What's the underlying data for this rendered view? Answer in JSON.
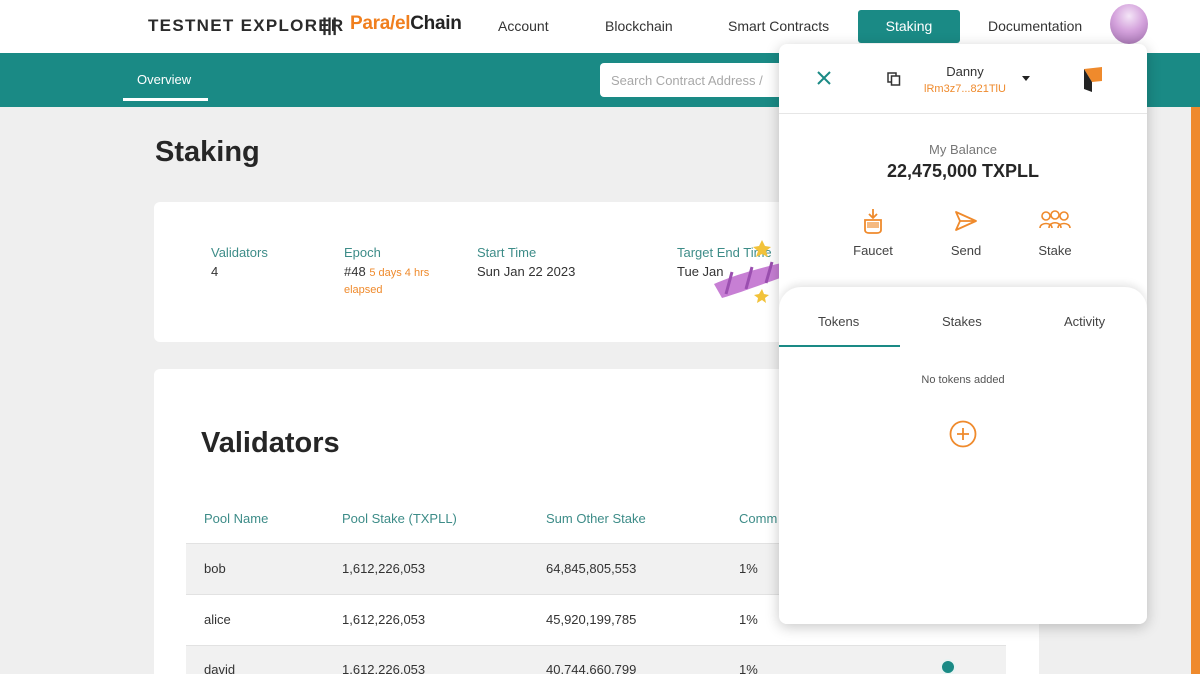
{
  "header": {
    "brand": "TESTNET EXPLORER",
    "separator": "|||",
    "logo_part1": "Para",
    "logo_part2": "/el",
    "logo_part3": "Chain",
    "nav": [
      "Account",
      "Blockchain",
      "Smart Contracts",
      "Staking",
      "Documentation"
    ]
  },
  "subheader": {
    "tab": "Overview",
    "search_placeholder": "Search Contract Address /"
  },
  "page": {
    "title": "Staking",
    "stats": {
      "validators_label": "Validators",
      "validators_value": "4",
      "epoch_label": "Epoch",
      "epoch_value": "#48",
      "epoch_elapsed_1": "5 days 4 hrs",
      "epoch_elapsed_2": "elapsed",
      "start_label": "Start Time",
      "start_value": "Sun Jan 22 2023",
      "end_label": "Target End Time",
      "end_value": "Tue Jan"
    },
    "validators_title": "Validators",
    "columns": [
      "Pool Name",
      "Pool Stake (TXPLL)",
      "Sum Other Stake",
      "Comm"
    ],
    "rows": [
      {
        "name": "bob",
        "stake": "1,612,226,053",
        "other": "64,845,805,553",
        "comm": "1%"
      },
      {
        "name": "alice",
        "stake": "1,612,226,053",
        "other": "45,920,199,785",
        "comm": "1%"
      },
      {
        "name": "david",
        "stake": "1,612,226,053",
        "other": "40,744,660,799",
        "comm": "1%"
      }
    ]
  },
  "wallet": {
    "name": "Danny",
    "address": "lRm3z7...821TlU",
    "balance_label": "My Balance",
    "balance": "22,475,000 TXPLL",
    "actions": [
      "Faucet",
      "Send",
      "Stake"
    ],
    "tabs": [
      "Tokens",
      "Stakes",
      "Activity"
    ],
    "empty_text": "No tokens added"
  },
  "colors": {
    "teal": "#1a8a85",
    "orange": "#ef8a2c",
    "background": "#efefef"
  }
}
